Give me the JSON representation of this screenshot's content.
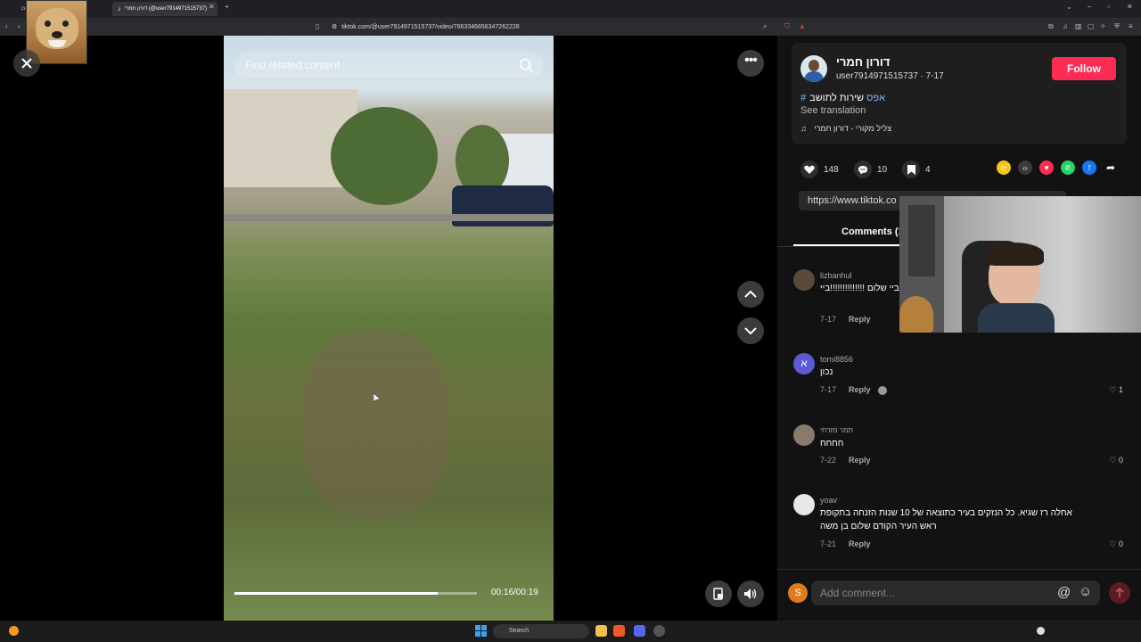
{
  "browser": {
    "tabs": [
      {
        "label": "הח גבם"
      },
      {
        "label": "דורון חמרי (@user7914971515737)"
      }
    ],
    "url": "tiktok.com/@user7914971515737/video/7663346656347262228"
  },
  "video": {
    "search_placeholder": "Find related content",
    "time": "00:16/00:19",
    "progress_fraction": 0.84
  },
  "author": {
    "display_name": "דורון חמרי",
    "username_date": "user7914971515737 · 7-17",
    "follow_label": "Follow",
    "hashtag": "#אפס",
    "caption": "שירות לתושב",
    "see_translation": "See translation",
    "sound": "צליל מקורי - דורון חמרי"
  },
  "stats": {
    "likes": "148",
    "comments": "10",
    "saves": "4"
  },
  "share": {
    "link_text": "https://www.tiktok.co"
  },
  "tabs": {
    "comments_label": "Comments (1"
  },
  "comments": [
    {
      "user": "lizbanhul",
      "text": "ביי שלום ביי שלום ביי שלום !!!!!!!!!!!!!!ביי",
      "date": "7-17",
      "reply": "Reply",
      "likes": ""
    },
    {
      "user": "tomi8856",
      "avatar_letter": "א",
      "text": "נכון",
      "date": "7-17",
      "reply": "Reply",
      "likes": "1"
    },
    {
      "user": "תמר מזרחי",
      "text": "חחחח",
      "date": "7-22",
      "reply": "Reply",
      "likes": "0"
    },
    {
      "user": "yoav",
      "text": "אחלה רז שגיא. כל הנזקים בעיר כתוצאה של 10 שנות הזנחה בתקופת ראש העיר הקודם שלום בן משה",
      "date": "7-21",
      "reply": "Reply",
      "likes": "0"
    }
  ],
  "comment_box": {
    "avatar_letter": "S",
    "placeholder": "Add comment..."
  },
  "taskbar": {
    "search_label": "Search"
  },
  "colors": {
    "accent": "#fe2c55",
    "panel": "#121212"
  }
}
